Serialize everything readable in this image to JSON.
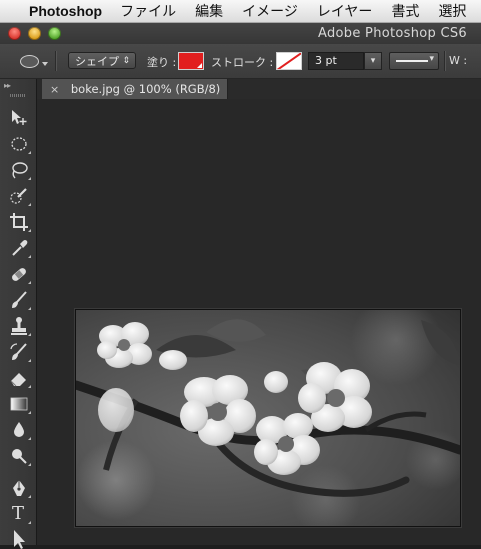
{
  "menubar": {
    "app_name": "Photoshop",
    "menus": [
      "ファイル",
      "編集",
      "イメージ",
      "レイヤー",
      "書式",
      "選択"
    ]
  },
  "window": {
    "title": "Adobe Photoshop CS6"
  },
  "options_bar": {
    "mode_select": "シェイプ",
    "fill_label": "塗り :",
    "fill_color": "#e21f1f",
    "stroke_label": "ストローク :",
    "stroke_color": "none",
    "stroke_width": "3 pt",
    "width_label": "W :"
  },
  "document_tab": {
    "close_glyph": "×",
    "title": "boke.jpg @ 100% (RGB/8) *"
  },
  "toolbar": {
    "collapse_glyph": "▸▸",
    "text_tool_glyph": "T",
    "tools": [
      "move-tool",
      "marquee-tool",
      "lasso-tool",
      "quick-selection-tool",
      "crop-tool",
      "eyedropper-tool",
      "healing-brush-tool",
      "brush-tool",
      "clone-stamp-tool",
      "history-brush-tool",
      "eraser-tool",
      "gradient-tool",
      "blur-tool",
      "dodge-tool",
      "pen-tool",
      "type-tool",
      "path-selection-tool"
    ]
  },
  "colors": {
    "menubar_bg": "#e9e9e9",
    "ui_dark": "#3c3c3c",
    "workspace": "#282828"
  }
}
